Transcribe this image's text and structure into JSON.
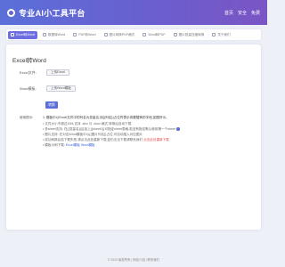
{
  "header": {
    "title": "专业AI小工具平台",
    "nav": [
      "首页",
      "安全",
      "免费"
    ]
  },
  "tabs": [
    {
      "label": "Excel转Word",
      "active": true
    },
    {
      "label": "数据转Word",
      "active": false
    },
    {
      "label": "PDF转Word",
      "active": false
    },
    {
      "label": "图片转换PDF格式",
      "active": false
    },
    {
      "label": "Word转PDF",
      "active": false
    },
    {
      "label": "图片批量压缩转换",
      "active": false
    },
    {
      "label": "关于我们",
      "active": false
    }
  ],
  "card": {
    "title": "Excel转Word",
    "excel_label": "Excel文件:",
    "excel_btn": "上传Excel",
    "word_label": "Word模板:",
    "word_btn": "上传Word模板",
    "convert_btn": "转换",
    "notes_label": "使用提示:",
    "notes": [
      "1. 模板中以Excel文件中的列名为变量名,用{{列名}}占位符表示将要替换的字段,如图所示。",
      "• 文件大小不超过10M,支持 .xlsx 与 .docx 格式,转换后自动下载",
      "• 多sheet支持: 在{{变量名}}后加上{{sheet1}}可指定sheet表格,若没有指定默认使用第一个sheet",
      "• 图片支持: 在对应Word模板中以{{图片列名}}占位,可自动插入对应图片",
      "• 成功转换后若下载失败,请点击此处重新下载,如仍无法下载请联系我们",
      "• 模板示例下载:"
    ],
    "note_red": "点击此处重新下载",
    "note_links": [
      "Excel模板",
      "Word模板"
    ]
  },
  "footer": "© 2023 版权所有 | 网站介绍 | 联系我们"
}
